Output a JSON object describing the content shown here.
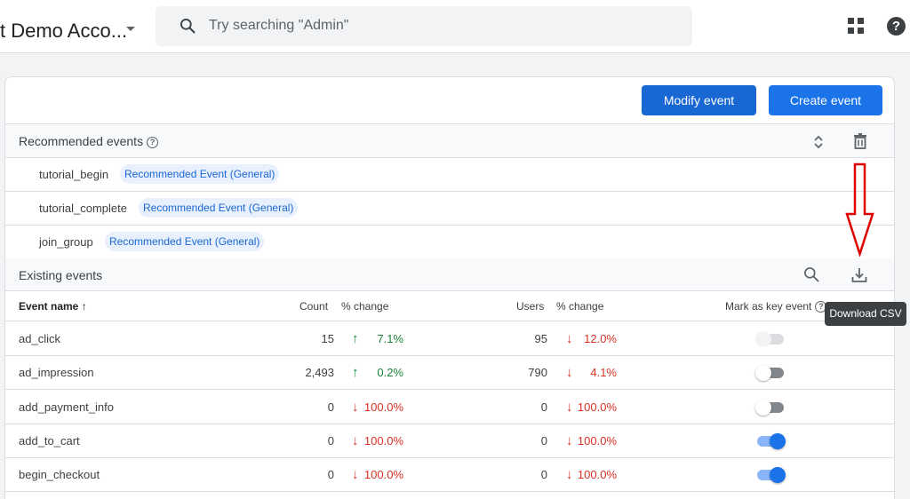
{
  "header": {
    "account_name": "t Demo Acco...",
    "search_placeholder": "Try searching \"Admin\"",
    "help_glyph": "?"
  },
  "toolbar": {
    "modify_label": "Modify event",
    "create_label": "Create event"
  },
  "recommended": {
    "title": "Recommended events",
    "items": [
      {
        "name": "tutorial_begin",
        "tag": "Recommended Event (General)"
      },
      {
        "name": "tutorial_complete",
        "tag": "Recommended Event (General)"
      },
      {
        "name": "join_group",
        "tag": "Recommended Event (General)"
      }
    ]
  },
  "existing": {
    "title": "Existing events",
    "download_tooltip": "Download CSV",
    "columns": {
      "event_name": "Event name",
      "count": "Count",
      "count_change": "% change",
      "users": "Users",
      "users_change": "% change",
      "key_event": "Mark as key event"
    },
    "rows": [
      {
        "name": "ad_click",
        "count": "15",
        "count_change": "7.1%",
        "count_dir": "up",
        "users": "95",
        "users_change": "12.0%",
        "users_dir": "down",
        "key_event": "disabled"
      },
      {
        "name": "ad_impression",
        "count": "2,493",
        "count_change": "0.2%",
        "count_dir": "up",
        "users": "790",
        "users_change": "4.1%",
        "users_dir": "down",
        "key_event": "off"
      },
      {
        "name": "add_payment_info",
        "count": "0",
        "count_change": "100.0%",
        "count_dir": "down",
        "users": "0",
        "users_change": "100.0%",
        "users_dir": "down",
        "key_event": "off"
      },
      {
        "name": "add_to_cart",
        "count": "0",
        "count_change": "100.0%",
        "count_dir": "down",
        "users": "0",
        "users_change": "100.0%",
        "users_dir": "down",
        "key_event": "on"
      },
      {
        "name": "begin_checkout",
        "count": "0",
        "count_change": "100.0%",
        "count_dir": "down",
        "users": "0",
        "users_change": "100.0%",
        "users_dir": "down",
        "key_event": "on"
      }
    ]
  },
  "colors": {
    "accent": "#1a73e8",
    "up": "#188038",
    "down": "#d93025",
    "annotation": "#e00000"
  }
}
